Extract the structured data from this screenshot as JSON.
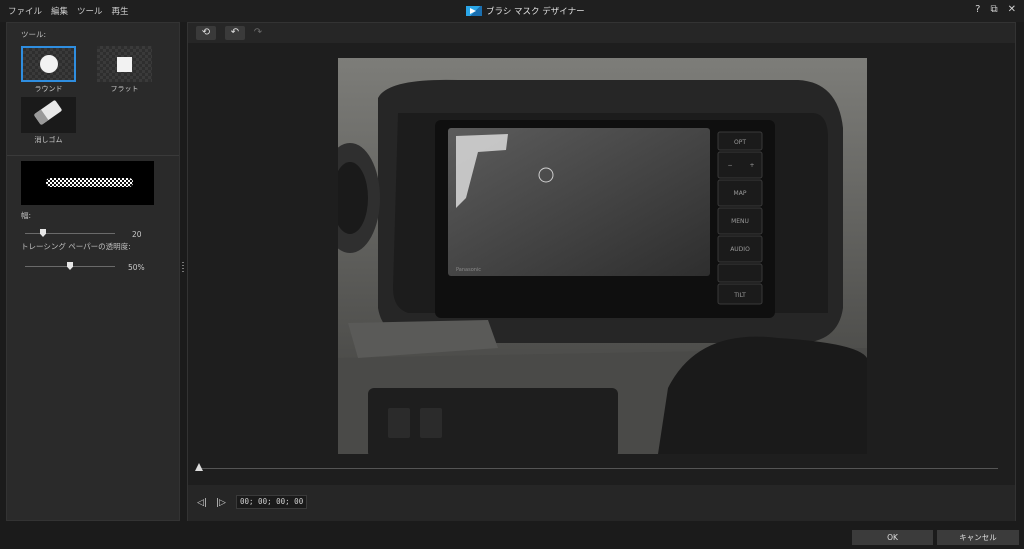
{
  "menu": {
    "items": [
      "ファイル",
      "編集",
      "ツール",
      "再生"
    ]
  },
  "window": {
    "title": "ブラシ マスク デザイナー",
    "help": "?",
    "restore": "⧉",
    "close": "✕"
  },
  "tools_panel": {
    "tools_label": "ツール:",
    "tools": [
      {
        "label": "ラウンド",
        "selected": true
      },
      {
        "label": "フラット",
        "selected": false
      },
      {
        "label": "消しゴム",
        "selected": false
      }
    ],
    "width_label": "幅:",
    "width_value": "20",
    "opacity_label": "トレーシング ペーパーの透明度:",
    "opacity_value": "50%"
  },
  "toolbar": {
    "reset_icon": "⟲",
    "undo_icon": "↶",
    "redo_icon": "↷"
  },
  "playback": {
    "prev_icon": "◁|",
    "next_icon": "|▷",
    "timecode": "00; 00; 00; 00"
  },
  "canvas": {
    "device_buttons": [
      "OPT",
      "−",
      "+",
      "MAP",
      "MENU",
      "AUDIO",
      "TILT"
    ],
    "brand": "Panasonic"
  },
  "footer": {
    "ok_label": "OK",
    "cancel_label": "キャンセル"
  },
  "colors": {
    "accent": "#2f8ee0",
    "panel": "#2a2a2a",
    "background": "#1b1b1b"
  }
}
